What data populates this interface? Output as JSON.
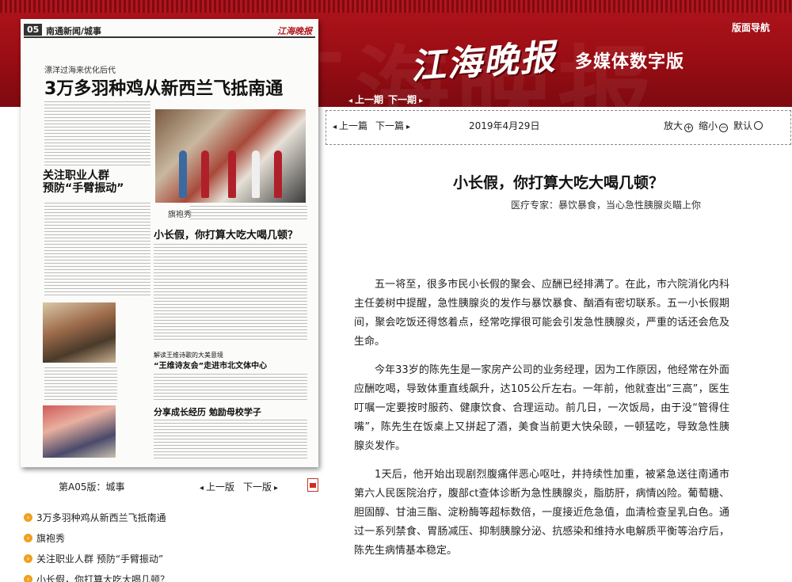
{
  "header": {
    "logo_main": "江海晚报",
    "logo_sub": "多媒体数字版",
    "nav_link": "版面导航",
    "prev_issue": "上一期",
    "next_issue": "下一期"
  },
  "newspaper_page": {
    "page_no": "05",
    "section": "南通新闻/城事",
    "brand": "江海晚报",
    "kicker": "漂洋过海来优化后代",
    "headline": "3万多羽种鸡从新西兰飞抵南通",
    "left_headline": "关注职业人群\n预防“手臂振动”",
    "photo_caption": "旗袍秀",
    "mid_headline": "小长假，你打算大吃大喝几顿？",
    "poem_headline": "“王维诗友会”走进市北文体中心",
    "share_headline": "分享成长经历  勉励母校学子"
  },
  "page_info": {
    "label": "第A05版：城事",
    "prev_page": "上一版",
    "next_page": "下一版"
  },
  "article_list": [
    "3万多羽种鸡从新西兰飞抵南通",
    "旗袍秀",
    "关注职业人群 预防“手臂振动”",
    "小长假，你打算大吃大喝几顿？"
  ],
  "toolbar": {
    "prev_article": "上一篇",
    "next_article": "下一篇",
    "date": "2019年4月29日",
    "zoom_in": "放大",
    "zoom_out": "缩小",
    "default": "默认"
  },
  "article": {
    "title": "小长假，你打算大吃大喝几顿？",
    "subtitle": "医疗专家：暴饮暴食，当心急性胰腺炎瞄上你",
    "paragraphs": [
      "五一将至，很多市民小长假的聚会、应酬已经排满了。在此，市六院消化内科主任姜树中提醒，急性胰腺炎的发作与暴饮暴食、酗酒有密切联系。五一小长假期间，聚会吃饭还得悠着点，经常吃撑很可能会引发急性胰腺炎，严重的话还会危及生命。",
      "今年33岁的陈先生是一家房产公司的业务经理，因为工作原因，他经常在外面应酬吃喝，导致体重直线飙升，达105公斤左右。一年前，他就查出“三高”，医生叮嘱一定要按时服药、健康饮食、合理运动。前几日，一次饭局，由于没“管得住嘴”，陈先生在饭桌上又拼起了酒，美食当前更大快朵颐，一顿猛吃，导致急性胰腺炎发作。",
      "1天后，他开始出现剧烈腹痛伴恶心呕吐，并持续性加重，被紧急送往南通市第六人民医院治疗，腹部ct查体诊断为急性胰腺炎，脂肪肝，病情凶险。葡萄糖、胆固醇、甘油三酯、淀粉酶等超标数倍，一度接近危急值，血清检查呈乳白色。通过一系列禁食、胃肠减压、抑制胰腺分泌、抗感染和维持水电解质平衡等治疗后，陈先生病情基本稳定。"
    ]
  },
  "colors": {
    "banner_red": "#9a0d14",
    "bullet_orange": "#f0a020"
  }
}
